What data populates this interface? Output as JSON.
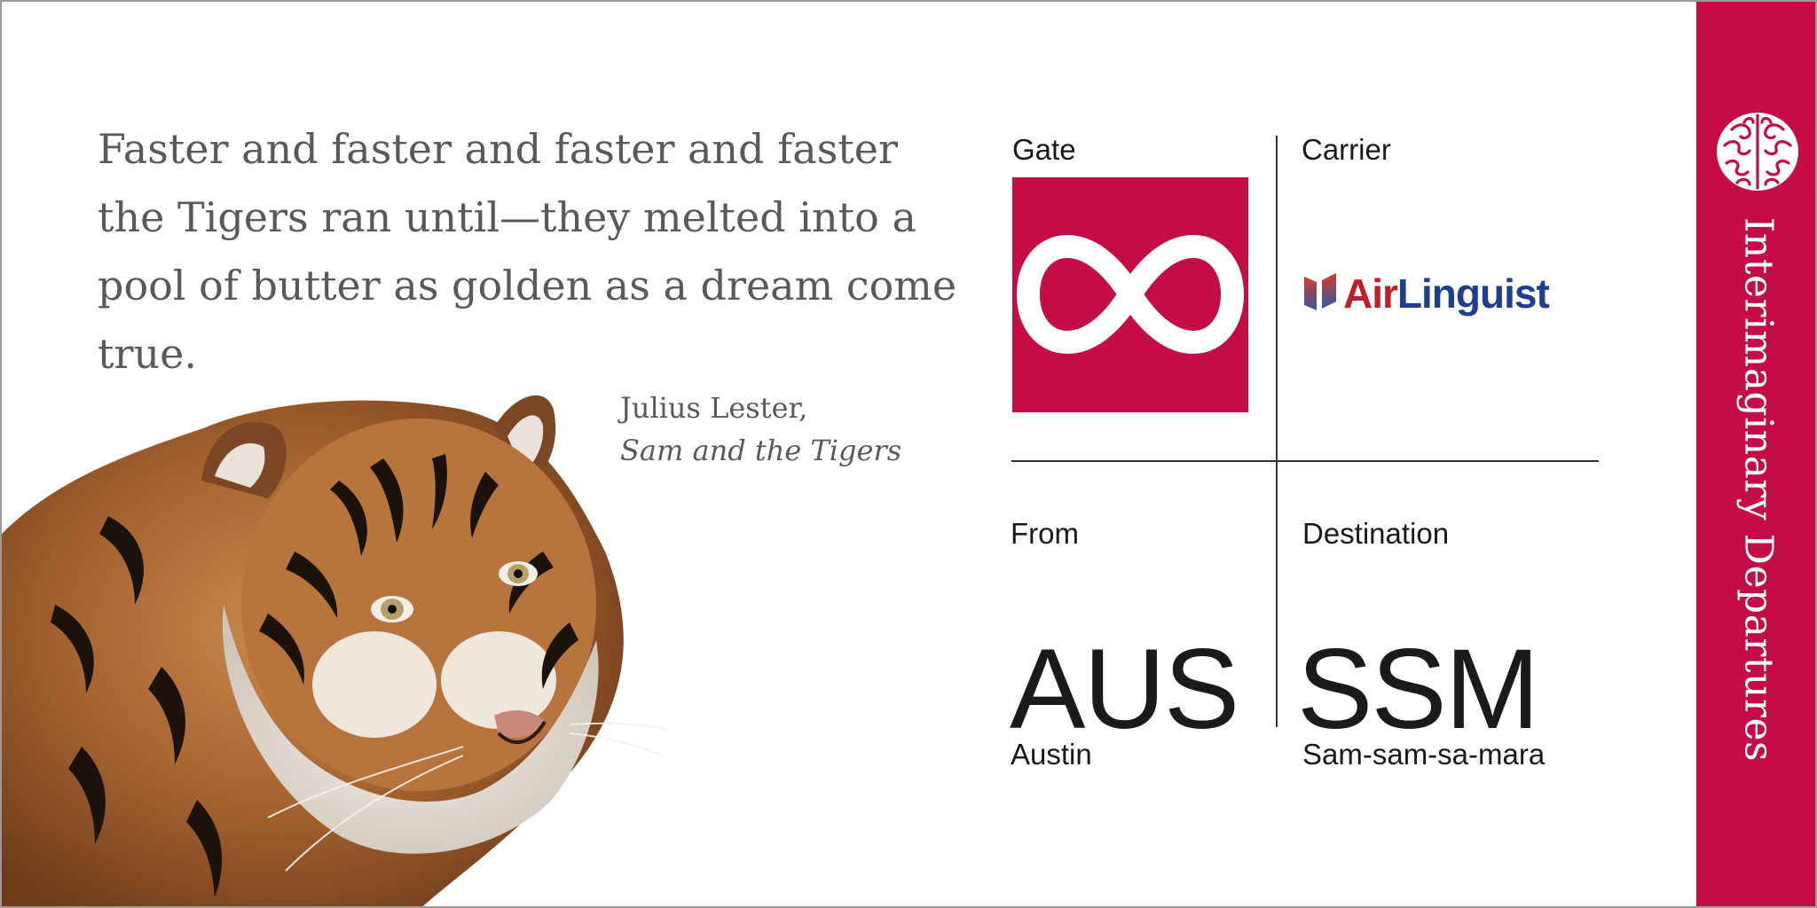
{
  "quote": {
    "text": "Faster and faster and faster and faster the Tigers ran until—they melted into a pool of butter as golden as a dream come true.",
    "author": "Julius Lester,",
    "book": "Sam and the Tigers"
  },
  "board": {
    "gate_label": "Gate",
    "carrier_label": "Carrier",
    "from_label": "From",
    "destination_label": "Destination",
    "from_code": "AUS",
    "from_city": "Austin",
    "destination_code": "SSM",
    "destination_city": "Sam-sam-sa-mara",
    "carrier_name_part1": "Air",
    "carrier_name_part2": "Linguist",
    "gate_icon": "infinity-icon"
  },
  "sidebar": {
    "title": "Interimaginary Departures",
    "icon": "brain-icon"
  },
  "colors": {
    "accent": "#c50d45",
    "text_gray": "#58595b",
    "carrier_red": "#c21d2b",
    "carrier_blue": "#1f3f8c"
  }
}
